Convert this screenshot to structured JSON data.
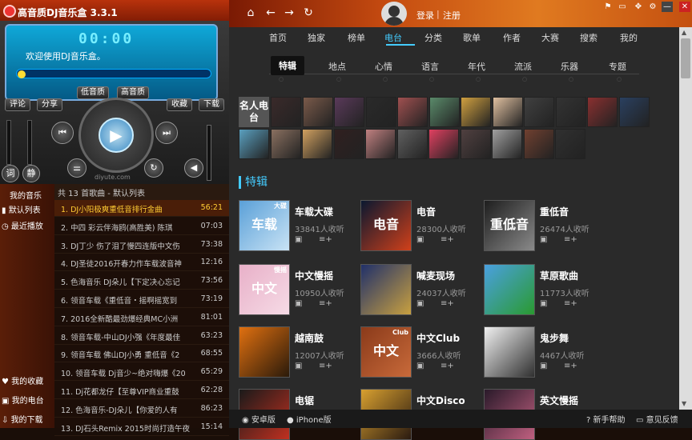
{
  "app": {
    "title": "高音质DJ音乐盒 3.3.1"
  },
  "topnav": {
    "home": "⌂",
    "back": "←",
    "forward": "→",
    "refresh": "↻",
    "login": "登录",
    "sep": "|",
    "register": "注册"
  },
  "window": {
    "skin": "⚑",
    "mini": "▭",
    "move": "✥",
    "settings": "⚙",
    "minimize": "—",
    "maximize": "□",
    "close": "✕"
  },
  "player": {
    "time": "00:00",
    "welcome": "欢迎使用DJ音乐盒。",
    "progress": 0.0,
    "bass_label": "低音质",
    "hq_label": "高音质",
    "comment_label": "评论",
    "share_label": "分享",
    "collect_label": "收藏",
    "download_label": "下载",
    "lyrics_label": "词",
    "mode_label": "静",
    "watermark": "diyute.com"
  },
  "sidebar": {
    "my_music": "我的音乐",
    "items": [
      {
        "label": "默认列表",
        "icon": "bars-icon"
      },
      {
        "label": "最近播放",
        "icon": "clock-icon"
      }
    ],
    "bottom_items": [
      {
        "label": "我的收藏",
        "icon": "heart-icon"
      },
      {
        "label": "我的电台",
        "icon": "radio-icon"
      },
      {
        "label": "我的下载",
        "icon": "download-icon"
      }
    ]
  },
  "playlist": {
    "header": "共 13 首歌曲 - 默认列表",
    "rows": [
      {
        "title": "1. DJ小阳极爽重低音排行金曲",
        "dur": "56:21",
        "active": true
      },
      {
        "title": "2. 中四 彩云伴海鸥(高胜美) 陈琪",
        "dur": "07:03"
      },
      {
        "title": "3. DJ丁少 伤了泪了慢四连版中文伤",
        "dur": "73:38"
      },
      {
        "title": "4. DJ圣徒2016开春力作车载波音神",
        "dur": "12:16"
      },
      {
        "title": "5. 色海音乐 DJ朵儿【下定决心忘记",
        "dur": "73:56"
      },
      {
        "title": "6. 领音车载《重低音・摇啊摇宽到",
        "dur": "73:19"
      },
      {
        "title": "7. 2016全新酷最劲爆经典MC小洲",
        "dur": "81:01"
      },
      {
        "title": "8. 领音车载-中山DJ小强《年度最佳",
        "dur": "63:23"
      },
      {
        "title": "9. 领音车载 佛山DJ小勇 重低音《2",
        "dur": "68:55"
      },
      {
        "title": "10. 领音车载 Dj音少~绝对嗨爆《20",
        "dur": "65:29"
      },
      {
        "title": "11. Dj花都龙仔【至尊VIP商业重鼓",
        "dur": "62:28"
      },
      {
        "title": "12. 色海音乐-DJ朵儿【你爱的人有",
        "dur": "86:23"
      },
      {
        "title": "13. DJ石头Remix 2015时尚打造午夜",
        "dur": "15:14"
      }
    ]
  },
  "nav1": [
    "首页",
    "独家",
    "榜单",
    "电台",
    "分类",
    "歌单",
    "作者",
    "大赛",
    "搜索",
    "我的"
  ],
  "nav1_active": 3,
  "nav2": [
    "特辑",
    "地点",
    "心情",
    "语言",
    "年代",
    "流派",
    "乐器",
    "专题"
  ],
  "nav2_active": 0,
  "announcers_label": "名人电台",
  "section_title": "特辑",
  "cards": [
    {
      "name": "车载大碟",
      "count": "33841人收听",
      "img_text": "车载",
      "img_sub": "大碟",
      "colors": [
        "#5aa0d8",
        "#c9e3f5"
      ]
    },
    {
      "name": "电音",
      "count": "28300人收听",
      "img_text": "电音",
      "img_sub": "",
      "colors": [
        "#0a1830",
        "#d0401a"
      ]
    },
    {
      "name": "重低音",
      "count": "26474人收听",
      "img_text": "重低音",
      "img_sub": "",
      "colors": [
        "#1e1e1e",
        "#8a8a8a"
      ]
    },
    {
      "name": "中文慢摇",
      "count": "10950人收听",
      "img_text": "中文",
      "img_sub": "慢摇",
      "colors": [
        "#e8b0c8",
        "#f6dbe6"
      ]
    },
    {
      "name": "喊麦现场",
      "count": "24037人收听",
      "img_text": "",
      "img_sub": "",
      "colors": [
        "#20306a",
        "#c8a040"
      ]
    },
    {
      "name": "草原歌曲",
      "count": "11773人收听",
      "img_text": "",
      "img_sub": "",
      "colors": [
        "#4aa0e0",
        "#2a9a30"
      ]
    },
    {
      "name": "越南鼓",
      "count": "12007人收听",
      "img_text": "",
      "img_sub": "",
      "colors": [
        "#e07010",
        "#2a1a0a"
      ]
    },
    {
      "name": "中文Club",
      "count": "3666人收听",
      "img_text": "中文",
      "img_sub": "Club",
      "colors": [
        "#8a3a1a",
        "#c86a3a"
      ]
    },
    {
      "name": "鬼步舞",
      "count": "4467人收听",
      "img_text": "",
      "img_sub": "",
      "colors": [
        "#f0f0f0",
        "#303030"
      ]
    },
    {
      "name": "电锯",
      "count": "",
      "img_text": "",
      "img_sub": "",
      "colors": [
        "#1a1a1a",
        "#c03020"
      ]
    },
    {
      "name": "中文Disco",
      "count": "",
      "img_text": "",
      "img_sub": "",
      "colors": [
        "#d8a030",
        "#2a1a10"
      ]
    },
    {
      "name": "英文慢摇",
      "count": "",
      "img_text": "",
      "img_sub": "",
      "colors": [
        "#2a1a2a",
        "#c06080"
      ]
    }
  ],
  "card_actions": {
    "play": "▣",
    "add": "≡+"
  },
  "bottom": {
    "android": "安卓版",
    "iphone": "iPhone版",
    "help": "新手帮助",
    "feedback": "意见反馈"
  }
}
